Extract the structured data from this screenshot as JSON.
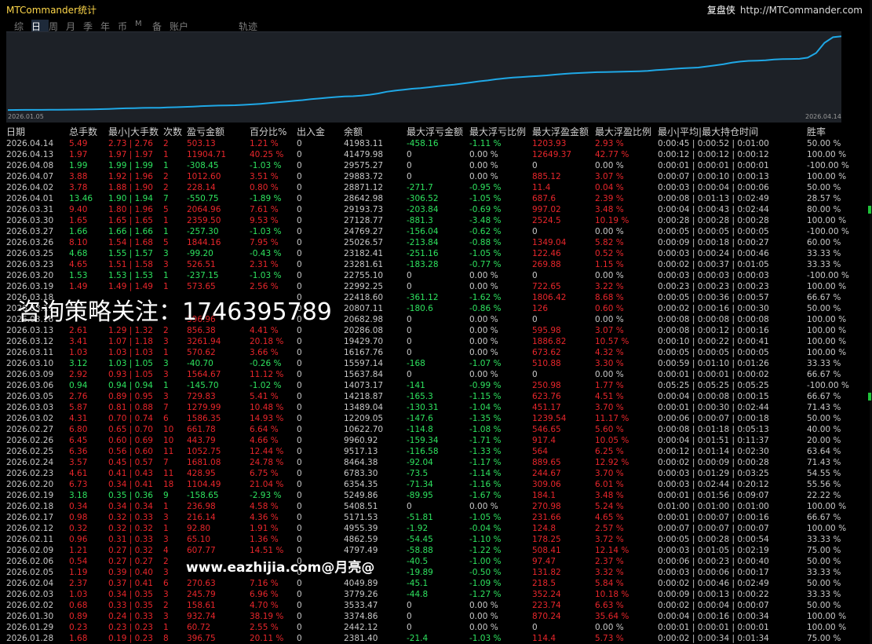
{
  "app": {
    "title": "MTCommander统计",
    "brand_cn": "复盘侠",
    "brand_url": "http://MTCommander.com"
  },
  "tabs": [
    {
      "label": "综",
      "active": false
    },
    {
      "label": "日",
      "active": true
    },
    {
      "label": "周",
      "active": false
    },
    {
      "label": "月",
      "active": false
    },
    {
      "label": "季",
      "active": false
    },
    {
      "label": "年",
      "active": false
    },
    {
      "label": "币",
      "active": false
    },
    {
      "label": "M",
      "active": false
    },
    {
      "label": "备",
      "active": false
    },
    {
      "label": "账户",
      "active": false
    },
    {
      "label": "轨迹",
      "active": false
    }
  ],
  "chart": {
    "start_date": "2026.01.05",
    "end_date": "2026.04.14",
    "line_color": "#1fa8e6",
    "background": "#1d2127"
  },
  "chart_data": {
    "type": "line",
    "series": [
      {
        "values": [
          2380,
          2440,
          2445,
          2450,
          2470,
          2520,
          2560,
          2600,
          2640,
          2690,
          2760,
          2840,
          2980,
          3120,
          3300,
          3380,
          3500,
          3540,
          3620,
          3780,
          3900,
          4050,
          4250,
          4500,
          4650,
          4800,
          4870,
          4950,
          5170,
          5410,
          5700,
          6100,
          6500,
          6900,
          7300,
          7700,
          8200,
          8600,
          9000,
          9400,
          9700,
          9800,
          10100,
          10600,
          11300,
          12200,
          12800,
          13300,
          13800,
          14100,
          14600,
          15100,
          15600,
          16000,
          16600,
          17200,
          17800,
          18300,
          18900,
          19400,
          19800,
          20100,
          20400,
          20700,
          21000,
          21400,
          21800,
          22100,
          22300,
          22500,
          22700,
          22800,
          22900,
          23000,
          23100,
          23200,
          23400,
          23800,
          24100,
          24500,
          24800,
          25000,
          25200,
          25800,
          26400,
          27000,
          27800,
          28400,
          28800,
          28900,
          29100,
          29500,
          29700,
          29800,
          29900,
          30500,
          33000,
          38500,
          41500,
          41983
        ]
      }
    ],
    "xlabel": "",
    "ylabel": "",
    "x_range": [
      "2026.01.05",
      "2026.04.14"
    ]
  },
  "table": {
    "headers": [
      "日期",
      "总手数",
      "最小|大手数",
      "次数",
      "盈亏金额",
      "百分比%",
      "出入金",
      "余额",
      "最大浮亏金额",
      "最大浮亏比例",
      "最大浮盈金额",
      "最大浮盈比例",
      "最小|平均|最大持仓时间",
      "胜率"
    ],
    "rows": [
      {
        "s": "r",
        "c": [
          "2026.04.14",
          "5.49",
          "2.73 | 2.76",
          "2",
          "503.13",
          "1.21 %",
          "0",
          "41983.11",
          "-458.16",
          "-1.11 %",
          "1203.93",
          "2.93 %",
          "0:00:45 | 0:00:52 | 0:01:00",
          "50.00 %"
        ]
      },
      {
        "s": "r",
        "c": [
          "2026.04.13",
          "1.97",
          "1.97 | 1.97",
          "1",
          "11904.71",
          "40.25 %",
          "0",
          "41479.98",
          "0",
          "0.00 %",
          "12649.37",
          "42.77 %",
          "0:00:12 | 0:00:12 | 0:00:12",
          "100.00 %"
        ]
      },
      {
        "s": "g",
        "c": [
          "2026.04.08",
          "1.99",
          "1.99 | 1.99",
          "1",
          "-308.45",
          "-1.03 %",
          "0",
          "29575.27",
          "0",
          "0.00 %",
          "0",
          "0.00 %",
          "0:00:01 | 0:00:01 | 0:00:01",
          "-100.00 %"
        ]
      },
      {
        "s": "r",
        "c": [
          "2026.04.07",
          "3.88",
          "1.92 | 1.96",
          "2",
          "1012.60",
          "3.51 %",
          "0",
          "29883.72",
          "0",
          "0.00 %",
          "885.12",
          "3.07 %",
          "0:00:07 | 0:00:10 | 0:00:13",
          "100.00 %"
        ]
      },
      {
        "s": "r",
        "c": [
          "2026.04.02",
          "3.78",
          "1.88 | 1.90",
          "2",
          "228.14",
          "0.80 %",
          "0",
          "28871.12",
          "-271.7",
          "-0.95 %",
          "11.4",
          "0.04 %",
          "0:00:03 | 0:00:04 | 0:00:06",
          "50.00 %"
        ]
      },
      {
        "s": "g",
        "c": [
          "2026.04.01",
          "13.46",
          "1.90 | 1.94",
          "7",
          "-550.75",
          "-1.89 %",
          "0",
          "28642.98",
          "-306.52",
          "-1.05 %",
          "687.6",
          "2.39 %",
          "0:00:08 | 0:01:13 | 0:02:49",
          "28.57 %"
        ]
      },
      {
        "s": "r",
        "c": [
          "2026.03.31",
          "9.40",
          "1.80 | 1.96",
          "5",
          "2064.96",
          "7.61 %",
          "0",
          "29193.73",
          "-203.84",
          "-0.69 %",
          "997.02",
          "3.48 %",
          "0:00:04 | 0:00:43 | 0:02:44",
          "80.00 %"
        ]
      },
      {
        "s": "r",
        "c": [
          "2026.03.30",
          "1.65",
          "1.65 | 1.65",
          "1",
          "2359.50",
          "9.53 %",
          "0",
          "27128.77",
          "-881.3",
          "-3.48 %",
          "2524.5",
          "10.19 %",
          "0:00:28 | 0:00:28 | 0:00:28",
          "100.00 %"
        ]
      },
      {
        "s": "g",
        "c": [
          "2026.03.27",
          "1.66",
          "1.66 | 1.66",
          "1",
          "-257.30",
          "-1.03 %",
          "0",
          "24769.27",
          "-156.04",
          "-0.62 %",
          "0",
          "0.00 %",
          "0:00:05 | 0:00:05 | 0:00:05",
          "-100.00 %"
        ]
      },
      {
        "s": "r",
        "c": [
          "2026.03.26",
          "8.10",
          "1.54 | 1.68",
          "5",
          "1844.16",
          "7.95 %",
          "0",
          "25026.57",
          "-213.84",
          "-0.88 %",
          "1349.04",
          "5.82 %",
          "0:00:09 | 0:00:18 | 0:00:27",
          "60.00 %"
        ]
      },
      {
        "s": "g",
        "c": [
          "2026.03.25",
          "4.68",
          "1.55 | 1.57",
          "3",
          "-99.20",
          "-0.43 %",
          "0",
          "23182.41",
          "-251.16",
          "-1.05 %",
          "122.46",
          "0.52 %",
          "0:00:03 | 0:00:24 | 0:00:46",
          "33.33 %"
        ]
      },
      {
        "s": "r",
        "c": [
          "2026.03.23",
          "4.65",
          "1.51 | 1.58",
          "3",
          "526.51",
          "2.31 %",
          "0",
          "23281.61",
          "-183.28",
          "-0.77 %",
          "269.88",
          "1.15 %",
          "0:00:02 | 0:00:37 | 0:01:05",
          "33.33 %"
        ]
      },
      {
        "s": "g",
        "c": [
          "2026.03.20",
          "1.53",
          "1.53 | 1.53",
          "1",
          "-237.15",
          "-1.03 %",
          "0",
          "22755.10",
          "0",
          "0.00 %",
          "0",
          "0.00 %",
          "0:00:03 | 0:00:03 | 0:00:03",
          "-100.00 %"
        ]
      },
      {
        "s": "r",
        "c": [
          "2026.03.19",
          "1.49",
          "1.49 | 1.49",
          "1",
          "573.65",
          "2.56 %",
          "0",
          "22992.25",
          "0",
          "0.00 %",
          "722.65",
          "3.22 %",
          "0:00:23 | 0:00:23 | 0:00:23",
          "100.00 %"
        ]
      },
      {
        "s": "r",
        "c": [
          "2026.03.18",
          "",
          "",
          "",
          "",
          "",
          "0",
          "22418.60",
          "-361.12",
          "-1.62 %",
          "1806.42",
          "8.68 %",
          "0:00:05 | 0:00:36 | 0:00:57",
          "66.67 %"
        ]
      },
      {
        "s": "r",
        "c": [
          "2026.03.17",
          "",
          "",
          "",
          "",
          "",
          "0",
          "20807.11",
          "-180.6",
          "-0.86 %",
          "126",
          "0.60 %",
          "0:00:02 | 0:00:16 | 0:00:30",
          "50.00 %"
        ]
      },
      {
        "s": "r",
        "c": [
          "2026.03.16",
          "",
          "",
          "",
          "396.96",
          "",
          "0",
          "20682.98",
          "0",
          "0.00 %",
          "0",
          "0.00 %",
          "0:00:08 | 0:00:08 | 0:00:08",
          "100.00 %"
        ]
      },
      {
        "s": "r",
        "c": [
          "2026.03.13",
          "2.61",
          "1.29 | 1.32",
          "2",
          "856.38",
          "4.41 %",
          "0",
          "20286.08",
          "0",
          "0.00 %",
          "595.98",
          "3.07 %",
          "0:00:08 | 0:00:12 | 0:00:16",
          "100.00 %"
        ]
      },
      {
        "s": "r",
        "c": [
          "2026.03.12",
          "3.41",
          "1.07 | 1.18",
          "3",
          "3261.94",
          "20.18 %",
          "0",
          "19429.70",
          "0",
          "0.00 %",
          "1886.82",
          "10.57 %",
          "0:00:10 | 0:00:22 | 0:00:41",
          "100.00 %"
        ]
      },
      {
        "s": "r",
        "c": [
          "2026.03.11",
          "1.03",
          "1.03 | 1.03",
          "1",
          "570.62",
          "3.66 %",
          "0",
          "16167.76",
          "0",
          "0.00 %",
          "673.62",
          "4.32 %",
          "0:00:05 | 0:00:05 | 0:00:05",
          "100.00 %"
        ]
      },
      {
        "s": "g",
        "c": [
          "2026.03.10",
          "3.12",
          "1.03 | 1.05",
          "3",
          "-40.70",
          "-0.26 %",
          "0",
          "15597.14",
          "-168",
          "-1.07 %",
          "510.88",
          "3.30 %",
          "0:00:59 | 0:01:10 | 0:01:26",
          "33.33 %"
        ]
      },
      {
        "s": "r",
        "c": [
          "2026.03.09",
          "2.92",
          "0.93 | 1.05",
          "3",
          "1564.67",
          "11.12 %",
          "0",
          "15637.84",
          "0",
          "0.00 %",
          "0",
          "0.00 %",
          "0:00:01 | 0:00:01 | 0:00:02",
          "66.67 %"
        ]
      },
      {
        "s": "g",
        "c": [
          "2026.03.06",
          "0.94",
          "0.94 | 0.94",
          "1",
          "-145.70",
          "-1.02 %",
          "0",
          "14073.17",
          "-141",
          "-0.99 %",
          "250.98",
          "1.77 %",
          "0:05:25 | 0:05:25 | 0:05:25",
          "-100.00 %"
        ]
      },
      {
        "s": "r",
        "c": [
          "2026.03.05",
          "2.76",
          "0.89 | 0.95",
          "3",
          "729.83",
          "5.41 %",
          "0",
          "14218.87",
          "-165.3",
          "-1.15 %",
          "623.76",
          "4.51 %",
          "0:00:04 | 0:00:08 | 0:00:15",
          "66.67 %"
        ]
      },
      {
        "s": "r",
        "c": [
          "2026.03.03",
          "5.87",
          "0.81 | 0.88",
          "7",
          "1279.99",
          "10.48 %",
          "0",
          "13489.04",
          "-130.31",
          "-1.04 %",
          "451.17",
          "3.70 %",
          "0:00:01 | 0:00:30 | 0:02:44",
          "71.43 %"
        ]
      },
      {
        "s": "r",
        "c": [
          "2026.03.02",
          "4.31",
          "0.70 | 0.74",
          "6",
          "1586.35",
          "14.93 %",
          "0",
          "12209.05",
          "-147.6",
          "-1.35 %",
          "1239.54",
          "11.17 %",
          "0:00:06 | 0:00:07 | 0:00:18",
          "50.00 %"
        ]
      },
      {
        "s": "r",
        "c": [
          "2026.02.27",
          "6.80",
          "0.65 | 0.70",
          "10",
          "661.78",
          "6.64 %",
          "0",
          "10622.70",
          "-114.8",
          "-1.08 %",
          "546.65",
          "5.60 %",
          "0:00:08 | 0:01:18 | 0:05:13",
          "40.00 %"
        ]
      },
      {
        "s": "r",
        "c": [
          "2026.02.26",
          "6.45",
          "0.60 | 0.69",
          "10",
          "443.79",
          "4.66 %",
          "0",
          "9960.92",
          "-159.34",
          "-1.71 %",
          "917.4",
          "10.05 %",
          "0:00:04 | 0:01:51 | 0:11:37",
          "20.00 %"
        ]
      },
      {
        "s": "r",
        "c": [
          "2026.02.25",
          "6.36",
          "0.56 | 0.60",
          "11",
          "1052.75",
          "12.44 %",
          "0",
          "9517.13",
          "-116.58",
          "-1.33 %",
          "564",
          "6.25 %",
          "0:00:12 | 0:01:14 | 0:02:30",
          "63.64 %"
        ]
      },
      {
        "s": "r",
        "c": [
          "2026.02.24",
          "3.57",
          "0.45 | 0.57",
          "7",
          "1681.08",
          "24.78 %",
          "0",
          "8464.38",
          "-92.04",
          "-1.17 %",
          "889.65",
          "12.92 %",
          "0:00:02 | 0:00:09 | 0:00:28",
          "71.43 %"
        ]
      },
      {
        "s": "r",
        "c": [
          "2026.02.23",
          "4.61",
          "0.41 | 0.43",
          "11",
          "428.95",
          "6.75 %",
          "0",
          "6783.30",
          "-73.5",
          "-1.14 %",
          "244.67",
          "3.70 %",
          "0:00:03 | 0:01:29 | 0:03:25",
          "54.55 %"
        ]
      },
      {
        "s": "r",
        "c": [
          "2026.02.20",
          "6.73",
          "0.34 | 0.41",
          "18",
          "1104.49",
          "21.04 %",
          "0",
          "6354.35",
          "-71.34",
          "-1.16 %",
          "309.06",
          "6.01 %",
          "0:00:03 | 0:02:44 | 0:20:12",
          "55.56 %"
        ]
      },
      {
        "s": "g",
        "c": [
          "2026.02.19",
          "3.18",
          "0.35 | 0.36",
          "9",
          "-158.65",
          "-2.93 %",
          "0",
          "5249.86",
          "-89.95",
          "-1.67 %",
          "184.1",
          "3.48 %",
          "0:00:01 | 0:01:56 | 0:09:07",
          "22.22 %"
        ]
      },
      {
        "s": "r",
        "c": [
          "2026.02.18",
          "0.34",
          "0.34 | 0.34",
          "1",
          "236.98",
          "4.58 %",
          "0",
          "5408.51",
          "0",
          "0.00 %",
          "270.98",
          "5.24 %",
          "0:01:00 | 0:01:00 | 0:01:00",
          "100.00 %"
        ]
      },
      {
        "s": "r",
        "c": [
          "2026.02.17",
          "0.98",
          "0.32 | 0.33",
          "3",
          "216.14",
          "4.36 %",
          "0",
          "5171.53",
          "-51.81",
          "-1.05 %",
          "231.66",
          "4.65 %",
          "0:00:01 | 0:00:07 | 0:00:16",
          "66.67 %"
        ]
      },
      {
        "s": "r",
        "c": [
          "2026.02.12",
          "0.32",
          "0.32 | 0.32",
          "1",
          "92.80",
          "1.91 %",
          "0",
          "4955.39",
          "-1.92",
          "-0.04 %",
          "124.8",
          "2.57 %",
          "0:00:07 | 0:00:07 | 0:00:07",
          "100.00 %"
        ]
      },
      {
        "s": "r",
        "c": [
          "2026.02.11",
          "0.96",
          "0.31 | 0.33",
          "3",
          "65.10",
          "1.36 %",
          "0",
          "4862.59",
          "-54.45",
          "-1.10 %",
          "178.25",
          "3.72 %",
          "0:00:05 | 0:00:28 | 0:00:54",
          "33.33 %"
        ]
      },
      {
        "s": "r",
        "c": [
          "2026.02.09",
          "1.21",
          "0.27 | 0.32",
          "4",
          "607.77",
          "14.51 %",
          "0",
          "4797.49",
          "-58.88",
          "-1.22 %",
          "508.41",
          "12.14 %",
          "0:00:03 | 0:01:05 | 0:02:19",
          "75.00 %"
        ]
      },
      {
        "s": "r",
        "c": [
          "2026.02.06",
          "0.54",
          "0.27 | 0.27",
          "2",
          "",
          "",
          "0",
          "",
          "-40.5",
          "-1.00 %",
          "97.47",
          "2.37 %",
          "0:00:06 | 0:00:23 | 0:00:40",
          "50.00 %"
        ]
      },
      {
        "s": "r",
        "c": [
          "2026.02.05",
          "1.19",
          "0.39 | 0.40",
          "3",
          "",
          "",
          "0",
          "",
          "-19.89",
          "-0.50 %",
          "131.82",
          "3.32 %",
          "0:00:03 | 0:00:06 | 0:00:17",
          "33.33 %"
        ]
      },
      {
        "s": "r",
        "c": [
          "2026.02.04",
          "2.37",
          "0.37 | 0.41",
          "6",
          "270.63",
          "7.16 %",
          "0",
          "4049.89",
          "-45.1",
          "-1.09 %",
          "218.5",
          "5.84 %",
          "0:00:02 | 0:00:46 | 0:02:49",
          "50.00 %"
        ]
      },
      {
        "s": "r",
        "c": [
          "2026.02.03",
          "1.03",
          "0.34 | 0.35",
          "3",
          "245.79",
          "6.96 %",
          "0",
          "3779.26",
          "-44.8",
          "-1.27 %",
          "352.24",
          "10.18 %",
          "0:00:09 | 0:00:13 | 0:00:22",
          "33.33 %"
        ]
      },
      {
        "s": "r",
        "c": [
          "2026.02.02",
          "0.68",
          "0.33 | 0.35",
          "2",
          "158.61",
          "4.70 %",
          "0",
          "3533.47",
          "0",
          "0.00 %",
          "223.74",
          "6.63 %",
          "0:00:02 | 0:00:04 | 0:00:07",
          "50.00 %"
        ]
      },
      {
        "s": "r",
        "c": [
          "2026.01.30",
          "0.89",
          "0.24 | 0.33",
          "3",
          "932.74",
          "38.19 %",
          "0",
          "3374.86",
          "0",
          "0.00 %",
          "870.24",
          "35.64 %",
          "0:00:04 | 0:00:16 | 0:00:34",
          "100.00 %"
        ]
      },
      {
        "s": "r",
        "c": [
          "2026.01.29",
          "0.23",
          "0.23 | 0.23",
          "1",
          "60.72",
          "2.55 %",
          "0",
          "2442.12",
          "0",
          "0.00 %",
          "0",
          "0.00 %",
          "0:00:01 | 0:00:01 | 0:00:01",
          "100.00 %"
        ]
      },
      {
        "s": "r",
        "c": [
          "2026.01.28",
          "1.68",
          "0.19 | 0.23",
          "8",
          "396.75",
          "20.11 %",
          "0",
          "2381.40",
          "-21.4",
          "-1.03 %",
          "114.4",
          "5.73 %",
          "0:00:02 | 0:00:34 | 0:01:34",
          "75.00 %"
        ]
      }
    ]
  },
  "overlays": {
    "consult": "咨询策略关注：1746395789",
    "site": "www.eazhijia.com@月亮@"
  }
}
